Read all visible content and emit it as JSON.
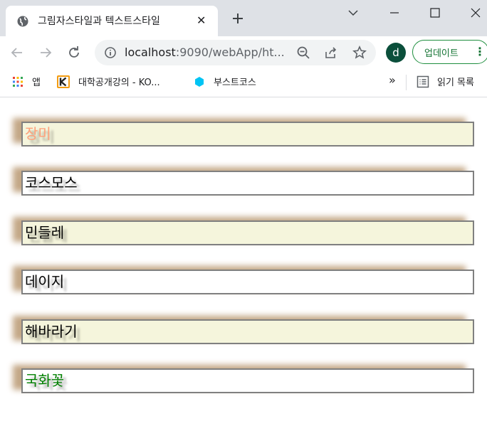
{
  "window": {
    "tab_title": "그림자스타일과 텍스트스타일",
    "tab_close": "✕"
  },
  "toolbar": {
    "url_host": "localhost",
    "url_rest": ":9090/webApp/ht...",
    "avatar_letter": "d",
    "update_label": "업데이트",
    "menu_dots": "⋮"
  },
  "bookmarks": {
    "apps": "앱",
    "kocw": "대학공개강의 - KO...",
    "boostcourse": "부스트코스",
    "more": "»",
    "reading_list": "읽기 목록"
  },
  "flowers": [
    {
      "label": "장미",
      "bg": "#f5f5dc",
      "color": "#ffa07a",
      "shadow": "rgba(0,0,0,0.35)"
    },
    {
      "label": "코스모스",
      "bg": "#ffffff",
      "color": "#000000",
      "shadow": "rgba(0,0,0,0.35)"
    },
    {
      "label": "민들레",
      "bg": "#f5f5dc",
      "color": "#000000",
      "shadow": "rgba(0,0,0,0.35)"
    },
    {
      "label": "데이지",
      "bg": "#ffffff",
      "color": "#000000",
      "shadow": "rgba(0,0,0,0.35)"
    },
    {
      "label": "해바라기",
      "bg": "#f5f5dc",
      "color": "#000000",
      "shadow": "rgba(0,0,0,0.35)"
    },
    {
      "label": "국화꽃",
      "bg": "#ffffff",
      "color": "#008000",
      "shadow": "rgba(0,0,0,0.35)"
    }
  ],
  "colors": {
    "border": "#808080",
    "box_shadow": "#c4a887",
    "accent": "#1e8e3e"
  }
}
